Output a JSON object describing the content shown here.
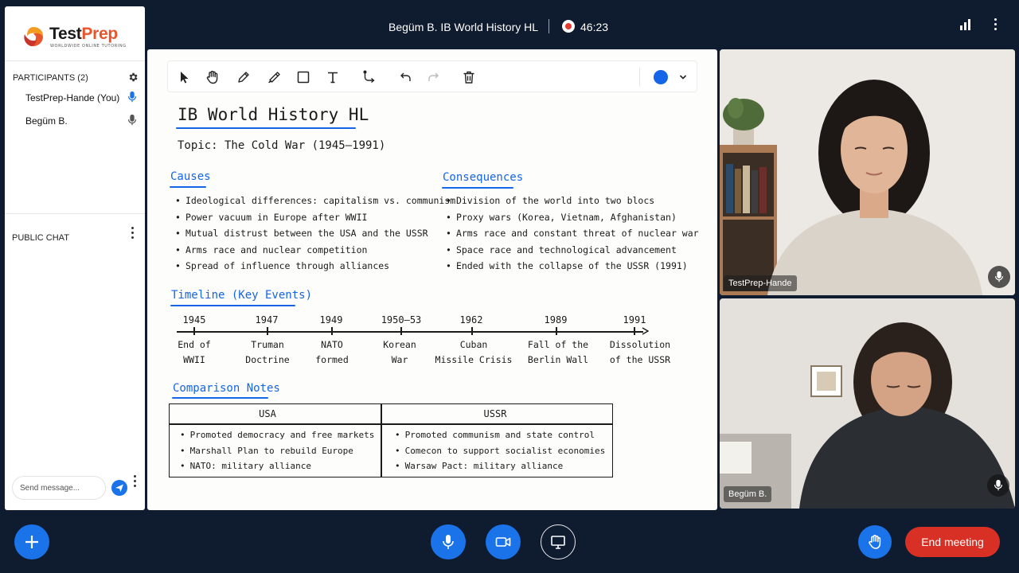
{
  "app": {
    "logo_main": "Test",
    "logo_accent": "Prep",
    "logo_tagline": "WORLDWIDE ONLINE TUTORING"
  },
  "meeting": {
    "title": "Begüm B. IB World History HL",
    "timer": "46:23"
  },
  "sidebar": {
    "participants_title": "PARTICIPANTS (2)",
    "participants": [
      {
        "name": "TestPrep-Hande (You)",
        "mic_color": "#1a73e8"
      },
      {
        "name": "Begüm B.",
        "mic_color": "#555555"
      }
    ],
    "chat_title": "PUBLIC CHAT",
    "chat_placeholder": "Send message..."
  },
  "toolbar": {
    "tools": [
      "cursor-icon",
      "hand-icon",
      "pen-icon",
      "highlighter-icon",
      "rectangle-icon",
      "text-icon",
      "connector-icon",
      "undo-icon",
      "redo-icon",
      "trash-icon"
    ],
    "active_color": "#1565e8"
  },
  "board": {
    "title": "IB World History HL",
    "topic": "Topic: The Cold War (1945–1991)",
    "causes": {
      "heading": "Causes",
      "items": [
        "Ideological differences: capitalism vs. communism",
        "Power vacuum in Europe after WWII",
        "Mutual distrust between the USA and the USSR",
        "Arms race and nuclear competition",
        "Spread of influence through alliances"
      ]
    },
    "consequences": {
      "heading": "Consequences",
      "items": [
        "Division of the world into two blocs",
        "Proxy wars (Korea, Vietnam, Afghanistan)",
        "Arms race and constant threat of nuclear war",
        "Space race and technological advancement",
        "Ended with the collapse of the USSR (1991)"
      ]
    },
    "timeline": {
      "heading": "Timeline (Key Events)",
      "events": [
        {
          "year": "1945",
          "line1": "End of",
          "line2": "WWII"
        },
        {
          "year": "1947",
          "line1": "Truman",
          "line2": "Doctrine"
        },
        {
          "year": "1949",
          "line1": "NATO",
          "line2": "formed"
        },
        {
          "year": "1950–53",
          "line1": "Korean",
          "line2": "War"
        },
        {
          "year": "1962",
          "line1": "Cuban",
          "line2": "Missile Crisis"
        },
        {
          "year": "1989",
          "line1": "Fall of the",
          "line2": "Berlin Wall"
        },
        {
          "year": "1991",
          "line1": "Dissolution",
          "line2": "of the USSR"
        }
      ]
    },
    "comparison": {
      "heading": "Comparison Notes",
      "usa": {
        "header": "USA",
        "items": [
          "Promoted democracy and free markets",
          "Marshall Plan to rebuild Europe",
          "NATO: military alliance"
        ]
      },
      "ussr": {
        "header": "USSR",
        "items": [
          "Promoted communism and state control",
          "Comecon to support socialist economies",
          "Warsaw Pact: military alliance"
        ]
      }
    }
  },
  "videos": [
    {
      "name": "TestPrep-Hande"
    },
    {
      "name": "Begüm B."
    }
  ],
  "controls": {
    "end_label": "End meeting"
  }
}
